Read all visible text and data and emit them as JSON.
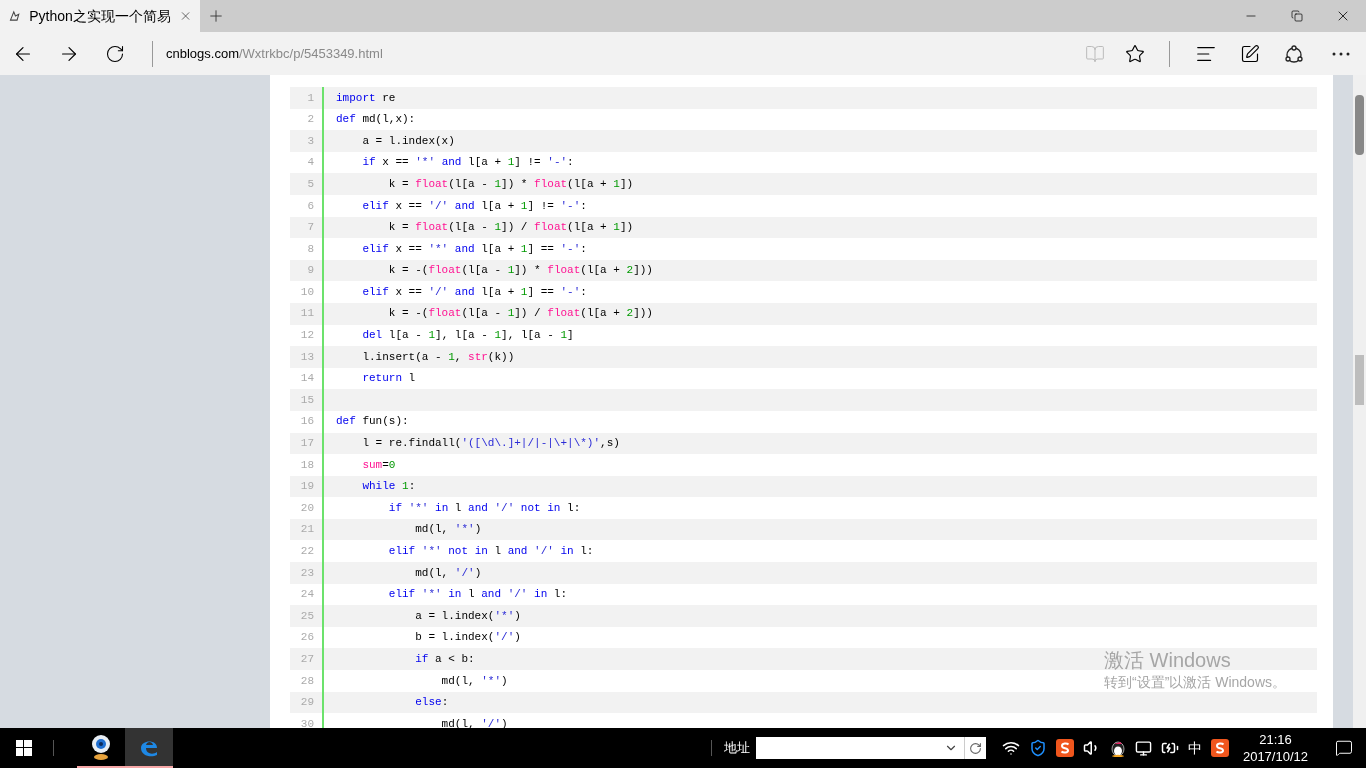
{
  "browser": {
    "tab": {
      "title": "Python之实现一个简易",
      "selected": true
    },
    "url": {
      "domain": "cnblogs.com",
      "path": "/Wxtrkbc/p/5453349.html"
    },
    "reading_view": {
      "disabled": true
    }
  },
  "code": {
    "lines": [
      {
        "number": "1",
        "tokens": [
          {
            "kind": "kw",
            "text": "import"
          },
          {
            "kind": "plain",
            "text": " re"
          }
        ]
      },
      {
        "number": "2",
        "tokens": [
          {
            "kind": "kw",
            "text": "def"
          },
          {
            "kind": "plain",
            "text": " md(l,x):"
          }
        ]
      },
      {
        "number": "3",
        "tokens": [
          {
            "kind": "plain",
            "text": "    a = l.index(x)"
          }
        ]
      },
      {
        "number": "4",
        "tokens": [
          {
            "kind": "kw",
            "text": "    if"
          },
          {
            "kind": "plain",
            "text": " x == "
          },
          {
            "kind": "str",
            "text": "'*' "
          },
          {
            "kind": "kw",
            "text": "and"
          },
          {
            "kind": "plain",
            "text": " l[a + "
          },
          {
            "kind": "num",
            "text": "1"
          },
          {
            "kind": "plain",
            "text": "] != "
          },
          {
            "kind": "str",
            "text": "'-'"
          },
          {
            "kind": "plain",
            "text": ":"
          }
        ]
      },
      {
        "number": "5",
        "tokens": [
          {
            "kind": "plain",
            "text": "        k = "
          },
          {
            "kind": "fn",
            "text": "float"
          },
          {
            "kind": "plain",
            "text": "(l[a - "
          },
          {
            "kind": "num",
            "text": "1"
          },
          {
            "kind": "plain",
            "text": "]) * "
          },
          {
            "kind": "fn",
            "text": "float"
          },
          {
            "kind": "plain",
            "text": "(l[a + "
          },
          {
            "kind": "num",
            "text": "1"
          },
          {
            "kind": "plain",
            "text": "])"
          }
        ]
      },
      {
        "number": "6",
        "tokens": [
          {
            "kind": "kw",
            "text": "    elif"
          },
          {
            "kind": "plain",
            "text": " x == "
          },
          {
            "kind": "str",
            "text": "'/' "
          },
          {
            "kind": "kw",
            "text": "and"
          },
          {
            "kind": "plain",
            "text": " l[a + "
          },
          {
            "kind": "num",
            "text": "1"
          },
          {
            "kind": "plain",
            "text": "] != "
          },
          {
            "kind": "str",
            "text": "'-'"
          },
          {
            "kind": "plain",
            "text": ":"
          }
        ]
      },
      {
        "number": "7",
        "tokens": [
          {
            "kind": "plain",
            "text": "        k = "
          },
          {
            "kind": "fn",
            "text": "float"
          },
          {
            "kind": "plain",
            "text": "(l[a - "
          },
          {
            "kind": "num",
            "text": "1"
          },
          {
            "kind": "plain",
            "text": "]) / "
          },
          {
            "kind": "fn",
            "text": "float"
          },
          {
            "kind": "plain",
            "text": "(l[a + "
          },
          {
            "kind": "num",
            "text": "1"
          },
          {
            "kind": "plain",
            "text": "])"
          }
        ]
      },
      {
        "number": "8",
        "tokens": [
          {
            "kind": "kw",
            "text": "    elif"
          },
          {
            "kind": "plain",
            "text": " x == "
          },
          {
            "kind": "str",
            "text": "'*' "
          },
          {
            "kind": "kw",
            "text": "and"
          },
          {
            "kind": "plain",
            "text": " l[a + "
          },
          {
            "kind": "num",
            "text": "1"
          },
          {
            "kind": "plain",
            "text": "] == "
          },
          {
            "kind": "str",
            "text": "'-'"
          },
          {
            "kind": "plain",
            "text": ":"
          }
        ]
      },
      {
        "number": "9",
        "tokens": [
          {
            "kind": "plain",
            "text": "        k = -("
          },
          {
            "kind": "fn",
            "text": "float"
          },
          {
            "kind": "plain",
            "text": "(l[a - "
          },
          {
            "kind": "num",
            "text": "1"
          },
          {
            "kind": "plain",
            "text": "]) * "
          },
          {
            "kind": "fn",
            "text": "float"
          },
          {
            "kind": "plain",
            "text": "(l[a + "
          },
          {
            "kind": "num",
            "text": "2"
          },
          {
            "kind": "plain",
            "text": "]))"
          }
        ]
      },
      {
        "number": "10",
        "tokens": [
          {
            "kind": "kw",
            "text": "    elif"
          },
          {
            "kind": "plain",
            "text": " x == "
          },
          {
            "kind": "str",
            "text": "'/' "
          },
          {
            "kind": "kw",
            "text": "and"
          },
          {
            "kind": "plain",
            "text": " l[a + "
          },
          {
            "kind": "num",
            "text": "1"
          },
          {
            "kind": "plain",
            "text": "] == "
          },
          {
            "kind": "str",
            "text": "'-'"
          },
          {
            "kind": "plain",
            "text": ":"
          }
        ]
      },
      {
        "number": "11",
        "tokens": [
          {
            "kind": "plain",
            "text": "        k = -("
          },
          {
            "kind": "fn",
            "text": "float"
          },
          {
            "kind": "plain",
            "text": "(l[a - "
          },
          {
            "kind": "num",
            "text": "1"
          },
          {
            "kind": "plain",
            "text": "]) / "
          },
          {
            "kind": "fn",
            "text": "float"
          },
          {
            "kind": "plain",
            "text": "(l[a + "
          },
          {
            "kind": "num",
            "text": "2"
          },
          {
            "kind": "plain",
            "text": "]))"
          }
        ]
      },
      {
        "number": "12",
        "tokens": [
          {
            "kind": "kw",
            "text": "    del"
          },
          {
            "kind": "plain",
            "text": " l[a - "
          },
          {
            "kind": "num",
            "text": "1"
          },
          {
            "kind": "plain",
            "text": "], l[a - "
          },
          {
            "kind": "num",
            "text": "1"
          },
          {
            "kind": "plain",
            "text": "], l[a - "
          },
          {
            "kind": "num",
            "text": "1"
          },
          {
            "kind": "plain",
            "text": "]"
          }
        ]
      },
      {
        "number": "13",
        "tokens": [
          {
            "kind": "plain",
            "text": "    l.insert(a - "
          },
          {
            "kind": "num",
            "text": "1"
          },
          {
            "kind": "plain",
            "text": ", "
          },
          {
            "kind": "fn",
            "text": "str"
          },
          {
            "kind": "plain",
            "text": "(k))"
          }
        ]
      },
      {
        "number": "14",
        "tokens": [
          {
            "kind": "kw",
            "text": "    return"
          },
          {
            "kind": "plain",
            "text": " l"
          }
        ]
      },
      {
        "number": "15"
      },
      {
        "number": "16",
        "tokens": [
          {
            "kind": "kw",
            "text": "def"
          },
          {
            "kind": "plain",
            "text": " fun(s):"
          }
        ]
      },
      {
        "number": "17",
        "tokens": [
          {
            "kind": "plain",
            "text": "    l = re.findall("
          },
          {
            "kind": "str",
            "text": "'([\\d\\.]+|/|-|\\+|\\*)'"
          },
          {
            "kind": "plain",
            "text": ",s)"
          }
        ]
      },
      {
        "number": "18",
        "tokens": [
          {
            "kind": "fn",
            "text": "    sum"
          },
          {
            "kind": "plain",
            "text": "="
          },
          {
            "kind": "num",
            "text": "0"
          }
        ]
      },
      {
        "number": "19",
        "tokens": [
          {
            "kind": "kw",
            "text": "    while "
          },
          {
            "kind": "num",
            "text": "1"
          },
          {
            "kind": "plain",
            "text": ":"
          }
        ]
      },
      {
        "number": "20",
        "tokens": [
          {
            "kind": "kw",
            "text": "        if "
          },
          {
            "kind": "str",
            "text": "'*' "
          },
          {
            "kind": "kw",
            "text": "in"
          },
          {
            "kind": "plain",
            "text": " l "
          },
          {
            "kind": "kw",
            "text": "and "
          },
          {
            "kind": "str",
            "text": "'/' "
          },
          {
            "kind": "kw",
            "text": "not in"
          },
          {
            "kind": "plain",
            "text": " l:"
          }
        ]
      },
      {
        "number": "21",
        "tokens": [
          {
            "kind": "plain",
            "text": "            md(l, "
          },
          {
            "kind": "str",
            "text": "'*'"
          },
          {
            "kind": "plain",
            "text": ")"
          }
        ]
      },
      {
        "number": "22",
        "tokens": [
          {
            "kind": "kw",
            "text": "        elif "
          },
          {
            "kind": "str",
            "text": "'*' "
          },
          {
            "kind": "kw",
            "text": "not in"
          },
          {
            "kind": "plain",
            "text": " l "
          },
          {
            "kind": "kw",
            "text": "and "
          },
          {
            "kind": "str",
            "text": "'/' "
          },
          {
            "kind": "kw",
            "text": "in"
          },
          {
            "kind": "plain",
            "text": " l:"
          }
        ]
      },
      {
        "number": "23",
        "tokens": [
          {
            "kind": "plain",
            "text": "            md(l, "
          },
          {
            "kind": "str",
            "text": "'/'"
          },
          {
            "kind": "plain",
            "text": ")"
          }
        ]
      },
      {
        "number": "24",
        "tokens": [
          {
            "kind": "kw",
            "text": "        elif "
          },
          {
            "kind": "str",
            "text": "'*' "
          },
          {
            "kind": "kw",
            "text": "in"
          },
          {
            "kind": "plain",
            "text": " l "
          },
          {
            "kind": "kw",
            "text": "and "
          },
          {
            "kind": "str",
            "text": "'/' "
          },
          {
            "kind": "kw",
            "text": "in"
          },
          {
            "kind": "plain",
            "text": " l:"
          }
        ]
      },
      {
        "number": "25",
        "tokens": [
          {
            "kind": "plain",
            "text": "            a = l.index("
          },
          {
            "kind": "str",
            "text": "'*'"
          },
          {
            "kind": "plain",
            "text": ")"
          }
        ]
      },
      {
        "number": "26",
        "tokens": [
          {
            "kind": "plain",
            "text": "            b = l.index("
          },
          {
            "kind": "str",
            "text": "'/'"
          },
          {
            "kind": "plain",
            "text": ")"
          }
        ]
      },
      {
        "number": "27",
        "tokens": [
          {
            "kind": "kw",
            "text": "            if"
          },
          {
            "kind": "plain",
            "text": " a < b:"
          }
        ]
      },
      {
        "number": "28",
        "tokens": [
          {
            "kind": "plain",
            "text": "                md(l, "
          },
          {
            "kind": "str",
            "text": "'*'"
          },
          {
            "kind": "plain",
            "text": ")"
          }
        ]
      },
      {
        "number": "29",
        "tokens": [
          {
            "kind": "kw",
            "text": "            else"
          },
          {
            "kind": "plain",
            "text": ":"
          }
        ]
      },
      {
        "number": "30",
        "tokens": [
          {
            "kind": "plain",
            "text": "                md(l, "
          },
          {
            "kind": "str",
            "text": "'/'"
          },
          {
            "kind": "plain",
            "text": ")"
          }
        ]
      }
    ]
  },
  "activation_notice": {
    "title": "激活 Windows",
    "subtitle": "转到“设置”以激活 Windows。"
  },
  "taskbar": {
    "apps": [
      {
        "kind": "webcam",
        "active": false
      },
      {
        "kind": "edge",
        "active": true
      }
    ],
    "address_label": "地址",
    "ime": "中",
    "time": "21:16",
    "date": "2017/10/12"
  }
}
